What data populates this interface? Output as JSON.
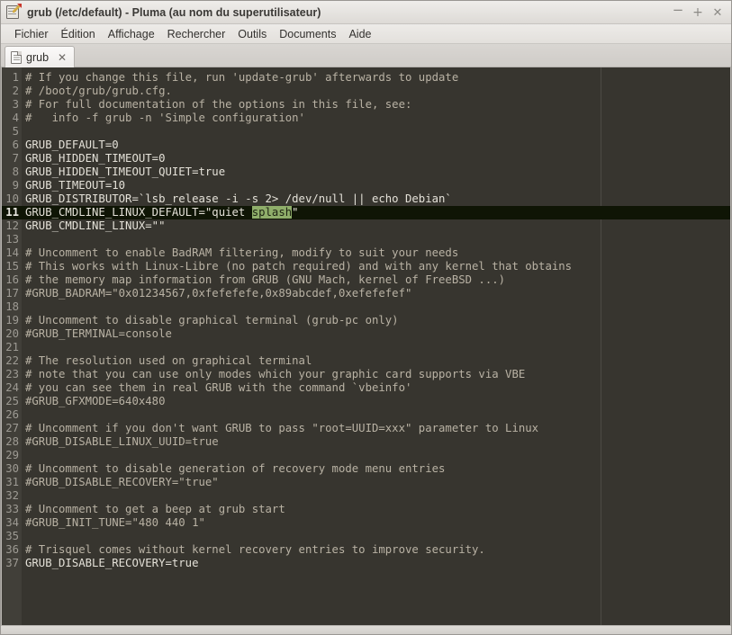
{
  "window": {
    "title": "grub (/etc/default) - Pluma (au nom du superutilisateur)",
    "app_icon": "notepad-pencil-icon",
    "controls": {
      "minimize": "−",
      "maximize": "+",
      "close": "✕"
    }
  },
  "menubar": {
    "items": [
      {
        "label": "Fichier"
      },
      {
        "label": "Édition"
      },
      {
        "label": "Affichage"
      },
      {
        "label": "Rechercher"
      },
      {
        "label": "Outils"
      },
      {
        "label": "Documents"
      },
      {
        "label": "Aide"
      }
    ]
  },
  "tabbar": {
    "tabs": [
      {
        "label": "grub",
        "icon": "document-icon",
        "close": "✕",
        "active": true
      }
    ]
  },
  "editor": {
    "current_line": 11,
    "selection_text": "splash",
    "colors": {
      "background": "#37352f",
      "gutter_background": "#413f39",
      "text": "#e4e1d8",
      "comment": "#b9b2a4",
      "current_line_highlight": "#0f1505",
      "selection_background": "#8fae6a",
      "selection_text": "#1d2312",
      "margin_guide": "#4c4a44",
      "line_number": "#9d9a93"
    },
    "lines": [
      {
        "n": 1,
        "parts": [
          {
            "t": "# If you change this file, run 'update-grub' afterwards to update",
            "k": "cm"
          }
        ]
      },
      {
        "n": 2,
        "parts": [
          {
            "t": "# /boot/grub/grub.cfg.",
            "k": "cm"
          }
        ]
      },
      {
        "n": 3,
        "parts": [
          {
            "t": "# For full documentation of the options in this file, see:",
            "k": "cm"
          }
        ]
      },
      {
        "n": 4,
        "parts": [
          {
            "t": "#   info -f grub -n 'Simple configuration'",
            "k": "cm"
          }
        ]
      },
      {
        "n": 5,
        "parts": [
          {
            "t": "",
            "k": "tx"
          }
        ]
      },
      {
        "n": 6,
        "parts": [
          {
            "t": "GRUB_DEFAULT=0",
            "k": "tx"
          }
        ]
      },
      {
        "n": 7,
        "parts": [
          {
            "t": "GRUB_HIDDEN_TIMEOUT=0",
            "k": "tx"
          }
        ]
      },
      {
        "n": 8,
        "parts": [
          {
            "t": "GRUB_HIDDEN_TIMEOUT_QUIET=true",
            "k": "tx"
          }
        ]
      },
      {
        "n": 9,
        "parts": [
          {
            "t": "GRUB_TIMEOUT=10",
            "k": "tx"
          }
        ]
      },
      {
        "n": 10,
        "parts": [
          {
            "t": "GRUB_DISTRIBUTOR=`lsb_release -i -s 2> /dev/null || echo Debian`",
            "k": "tx"
          }
        ]
      },
      {
        "n": 11,
        "current": true,
        "parts": [
          {
            "t": "GRUB_CMDLINE_LINUX_DEFAULT=\"quiet ",
            "k": "tx"
          },
          {
            "t": "splash",
            "k": "sel"
          },
          {
            "t": "\"",
            "k": "tx"
          }
        ]
      },
      {
        "n": 12,
        "parts": [
          {
            "t": "GRUB_CMDLINE_LINUX=\"\"",
            "k": "tx"
          }
        ]
      },
      {
        "n": 13,
        "parts": [
          {
            "t": "",
            "k": "tx"
          }
        ]
      },
      {
        "n": 14,
        "parts": [
          {
            "t": "# Uncomment to enable BadRAM filtering, modify to suit your needs",
            "k": "cm"
          }
        ]
      },
      {
        "n": 15,
        "parts": [
          {
            "t": "# This works with Linux-Libre (no patch required) and with any kernel that obtains",
            "k": "cm"
          }
        ]
      },
      {
        "n": 16,
        "parts": [
          {
            "t": "# the memory map information from GRUB (GNU Mach, kernel of FreeBSD ...)",
            "k": "cm"
          }
        ]
      },
      {
        "n": 17,
        "parts": [
          {
            "t": "#GRUB_BADRAM=\"0x01234567,0xfefefefe,0x89abcdef,0xefefefef\"",
            "k": "cm"
          }
        ]
      },
      {
        "n": 18,
        "parts": [
          {
            "t": "",
            "k": "tx"
          }
        ]
      },
      {
        "n": 19,
        "parts": [
          {
            "t": "# Uncomment to disable graphical terminal (grub-pc only)",
            "k": "cm"
          }
        ]
      },
      {
        "n": 20,
        "parts": [
          {
            "t": "#GRUB_TERMINAL=console",
            "k": "cm"
          }
        ]
      },
      {
        "n": 21,
        "parts": [
          {
            "t": "",
            "k": "tx"
          }
        ]
      },
      {
        "n": 22,
        "parts": [
          {
            "t": "# The resolution used on graphical terminal",
            "k": "cm"
          }
        ]
      },
      {
        "n": 23,
        "parts": [
          {
            "t": "# note that you can use only modes which your graphic card supports via VBE",
            "k": "cm"
          }
        ]
      },
      {
        "n": 24,
        "parts": [
          {
            "t": "# you can see them in real GRUB with the command `vbeinfo'",
            "k": "cm"
          }
        ]
      },
      {
        "n": 25,
        "parts": [
          {
            "t": "#GRUB_GFXMODE=640x480",
            "k": "cm"
          }
        ]
      },
      {
        "n": 26,
        "parts": [
          {
            "t": "",
            "k": "tx"
          }
        ]
      },
      {
        "n": 27,
        "parts": [
          {
            "t": "# Uncomment if you don't want GRUB to pass \"root=UUID=xxx\" parameter to Linux",
            "k": "cm"
          }
        ]
      },
      {
        "n": 28,
        "parts": [
          {
            "t": "#GRUB_DISABLE_LINUX_UUID=true",
            "k": "cm"
          }
        ]
      },
      {
        "n": 29,
        "parts": [
          {
            "t": "",
            "k": "tx"
          }
        ]
      },
      {
        "n": 30,
        "parts": [
          {
            "t": "# Uncomment to disable generation of recovery mode menu entries",
            "k": "cm"
          }
        ]
      },
      {
        "n": 31,
        "parts": [
          {
            "t": "#GRUB_DISABLE_RECOVERY=\"true\"",
            "k": "cm"
          }
        ]
      },
      {
        "n": 32,
        "parts": [
          {
            "t": "",
            "k": "tx"
          }
        ]
      },
      {
        "n": 33,
        "parts": [
          {
            "t": "# Uncomment to get a beep at grub start",
            "k": "cm"
          }
        ]
      },
      {
        "n": 34,
        "parts": [
          {
            "t": "#GRUB_INIT_TUNE=\"480 440 1\"",
            "k": "cm"
          }
        ]
      },
      {
        "n": 35,
        "parts": [
          {
            "t": "",
            "k": "tx"
          }
        ]
      },
      {
        "n": 36,
        "parts": [
          {
            "t": "# Trisquel comes without kernel recovery entries to improve security.",
            "k": "cm"
          }
        ]
      },
      {
        "n": 37,
        "parts": [
          {
            "t": "GRUB_DISABLE_RECOVERY=true",
            "k": "tx"
          }
        ]
      }
    ]
  }
}
